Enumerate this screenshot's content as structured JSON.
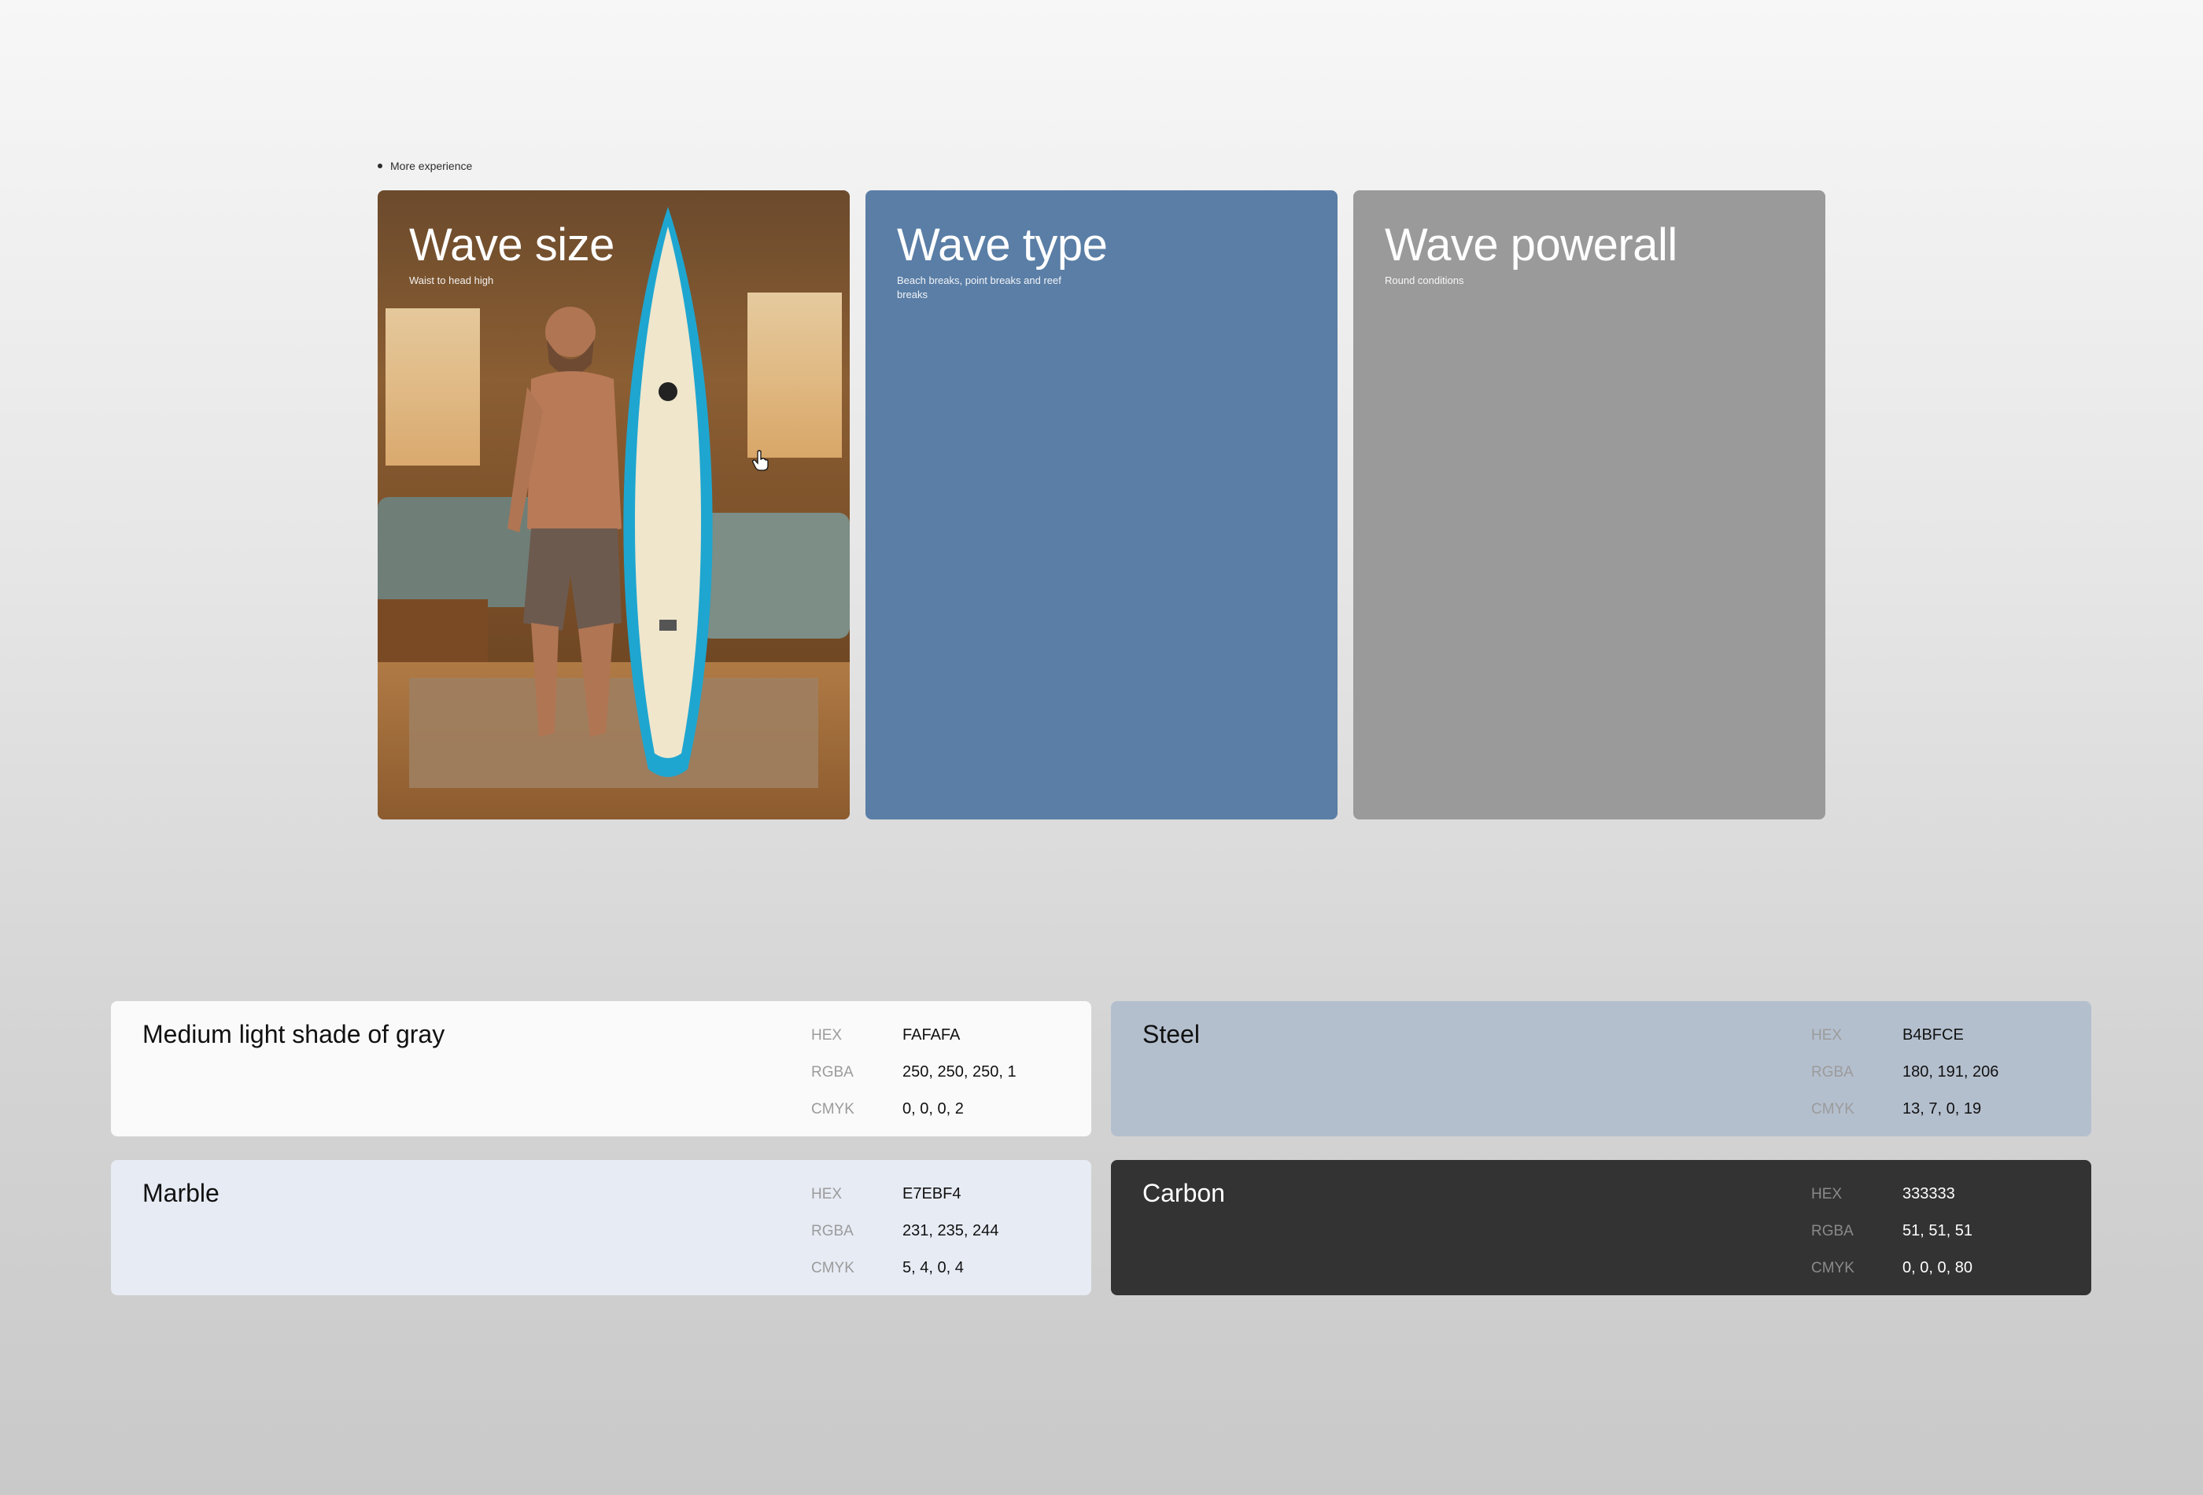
{
  "eyebrow": "More experience",
  "cards": [
    {
      "title": "Wave size",
      "subtitle": "Waist to head high",
      "background": "#7a4f28"
    },
    {
      "title": "Wave type",
      "subtitle": "Beach breaks, point breaks and reef breaks",
      "background": "#5a7ea6"
    },
    {
      "title": "Wave powerall",
      "subtitle": "Round conditions",
      "background": "#9a9a9a"
    }
  ],
  "swatches": [
    {
      "name": "Medium light shade of gray",
      "color": "#FAFAFA",
      "hex_label": "HEX",
      "hex": "FAFAFA",
      "rgba_label": "RGBA",
      "rgba": "250, 250, 250, 1",
      "cmyk_label": "CMYK",
      "cmyk": "0, 0, 0, 2"
    },
    {
      "name": "Steel",
      "color": "#B4BFCE",
      "hex_label": "HEX",
      "hex": "B4BFCE",
      "rgba_label": "RGBA",
      "rgba": "180, 191, 206",
      "cmyk_label": "CMYK",
      "cmyk": "13, 7, 0, 19"
    },
    {
      "name": "Marble",
      "color": "#E7EBF4",
      "hex_label": "HEX",
      "hex": "E7EBF4",
      "rgba_label": "RGBA",
      "rgba": "231, 235, 244",
      "cmyk_label": "CMYK",
      "cmyk": "5, 4, 0, 4"
    },
    {
      "name": "Carbon",
      "color": "#333333",
      "hex_label": "HEX",
      "hex": "333333",
      "rgba_label": "RGBA",
      "rgba": "51, 51, 51",
      "cmyk_label": "CMYK",
      "cmyk": "0, 0, 0, 80"
    }
  ]
}
